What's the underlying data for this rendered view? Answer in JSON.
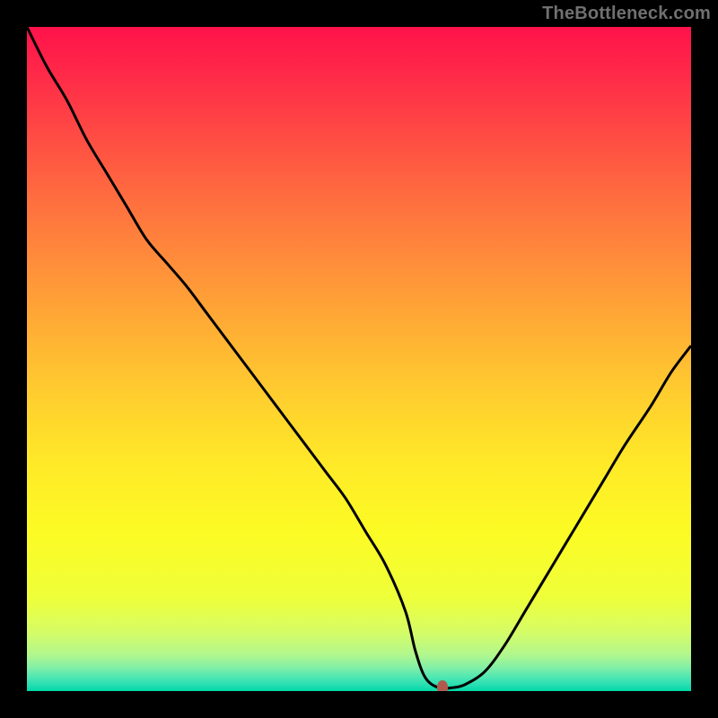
{
  "watermark": "TheBottleneck.com",
  "colors": {
    "page_bg": "#000000",
    "curve": "#000000",
    "marker": "#b05a4e",
    "gradient_stops": [
      {
        "offset": 0.0,
        "color": "#ff124b"
      },
      {
        "offset": 0.07,
        "color": "#ff2948"
      },
      {
        "offset": 0.16,
        "color": "#ff4a44"
      },
      {
        "offset": 0.26,
        "color": "#ff6e3f"
      },
      {
        "offset": 0.36,
        "color": "#ff8f3a"
      },
      {
        "offset": 0.46,
        "color": "#ffb034"
      },
      {
        "offset": 0.56,
        "color": "#ffcf2e"
      },
      {
        "offset": 0.66,
        "color": "#ffea28"
      },
      {
        "offset": 0.76,
        "color": "#fcfb24"
      },
      {
        "offset": 0.86,
        "color": "#eeff3a"
      },
      {
        "offset": 0.91,
        "color": "#d6fc65"
      },
      {
        "offset": 0.945,
        "color": "#b2f78d"
      },
      {
        "offset": 0.965,
        "color": "#80efa7"
      },
      {
        "offset": 0.98,
        "color": "#4ce6b3"
      },
      {
        "offset": 0.992,
        "color": "#22deb1"
      },
      {
        "offset": 1.0,
        "color": "#02d7a8"
      }
    ]
  },
  "chart_data": {
    "type": "line",
    "title": "",
    "xlabel": "",
    "ylabel": "",
    "xlim": [
      0,
      100
    ],
    "ylim": [
      0,
      100
    ],
    "grid": false,
    "legend": false,
    "x": [
      0,
      3,
      6,
      9,
      12,
      15,
      18,
      21,
      24,
      27,
      30,
      33,
      36,
      39,
      42,
      45,
      48,
      51,
      54,
      57,
      58.5,
      60,
      62,
      64,
      66,
      69,
      72,
      75,
      78,
      81,
      84,
      87,
      90,
      94,
      97,
      100
    ],
    "y": [
      100,
      94,
      89,
      83,
      78,
      73,
      68,
      64.5,
      61,
      57,
      53,
      49,
      45,
      41,
      37,
      33,
      29,
      24,
      19,
      12,
      6,
      2,
      0.5,
      0.5,
      1,
      3,
      7,
      12,
      17,
      22,
      27,
      32,
      37,
      43,
      48,
      52
    ],
    "marker": {
      "x": 62.5,
      "y": 0.5
    },
    "notes": "y-axis is inverted visually (0 at bottom = optimal / green). Values are approximate, read from the curve geometry; axes have no visible tick labels."
  }
}
